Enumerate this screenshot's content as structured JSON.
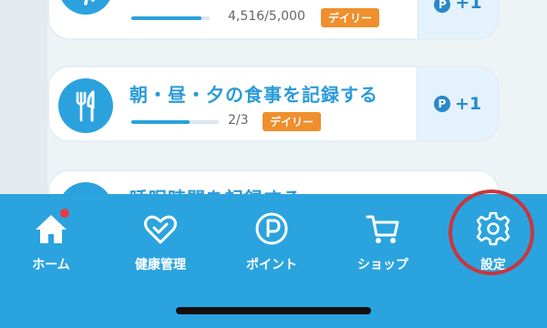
{
  "missions": [
    {
      "title": "",
      "progress_text": "4,516/5,000",
      "progress_fraction": 0.9,
      "badge": "デイリー",
      "reward": "+1",
      "icon": "running-icon"
    },
    {
      "title": "朝・昼・夕の食事を記録する",
      "progress_text": "2/3",
      "progress_fraction": 0.67,
      "badge": "デイリー",
      "reward": "+1",
      "icon": "fork-knife-icon"
    },
    {
      "title": "睡眠時間を記録する",
      "icon": "sleep-icon"
    }
  ],
  "reward_point_symbol": "P",
  "nav": {
    "items": [
      {
        "label": "ホーム",
        "icon": "home-icon"
      },
      {
        "label": "健康管理",
        "icon": "heart-check-icon"
      },
      {
        "label": "ポイント",
        "icon": "point-icon"
      },
      {
        "label": "ショップ",
        "icon": "cart-icon"
      },
      {
        "label": "設定",
        "icon": "gear-icon"
      }
    ]
  },
  "colors": {
    "nav_background": "#2ba3df",
    "accent": "#2a9bd8",
    "badge": "#ef8f2d",
    "highlight_ring": "#c9363d",
    "notification_dot": "#e63a46"
  }
}
